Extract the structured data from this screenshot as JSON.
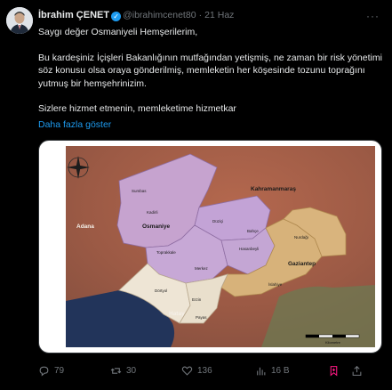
{
  "author": {
    "name": "İbrahim ÇENET",
    "handle": "@ibrahimcenet80",
    "separator": "·",
    "date": "21 Haz"
  },
  "body": {
    "p1": "Saygı değer Osmaniyeli Hemşerilerim,",
    "p2": "Bu kardeşiniz İçişleri Bakanlığının mutfağından yetişmiş, ne zaman bir risk yönetimi söz konusu olsa oraya gönderilmiş, memleketin her köşesinde tozunu toprağını yutmuş bir hemşehrinizim.",
    "p3": "Sizlere hizmet etmenin, memleketime hizmetkar",
    "show_more": "Daha fazla göster"
  },
  "map": {
    "labels": {
      "kahramanmaras": "Kahramanmaraş",
      "adana": "Adana",
      "osmaniye": "Osmaniye",
      "gaziantep": "Gaziantep",
      "hatay": "Hatay",
      "sumbas": "Sumbas",
      "kadirli": "Kadirli",
      "duzici": "Düziçi",
      "bahce": "Bahçe",
      "hasanbeyli": "Hasanbeyli",
      "toprakkale": "Toprakkale",
      "merkez": "Merkez",
      "nurdagi": "Nurdağı",
      "islahiye": "İslahiye",
      "payas": "Payas",
      "dortyol": "Dörtyol",
      "erzin": "Erzin",
      "scale": "Kilometre"
    }
  },
  "actions": {
    "replies": "79",
    "retweets": "30",
    "likes": "136",
    "views": "16 B"
  },
  "colors": {
    "accent": "#1d9bf0",
    "muted": "#71767b",
    "bookmark": "#f91880"
  }
}
